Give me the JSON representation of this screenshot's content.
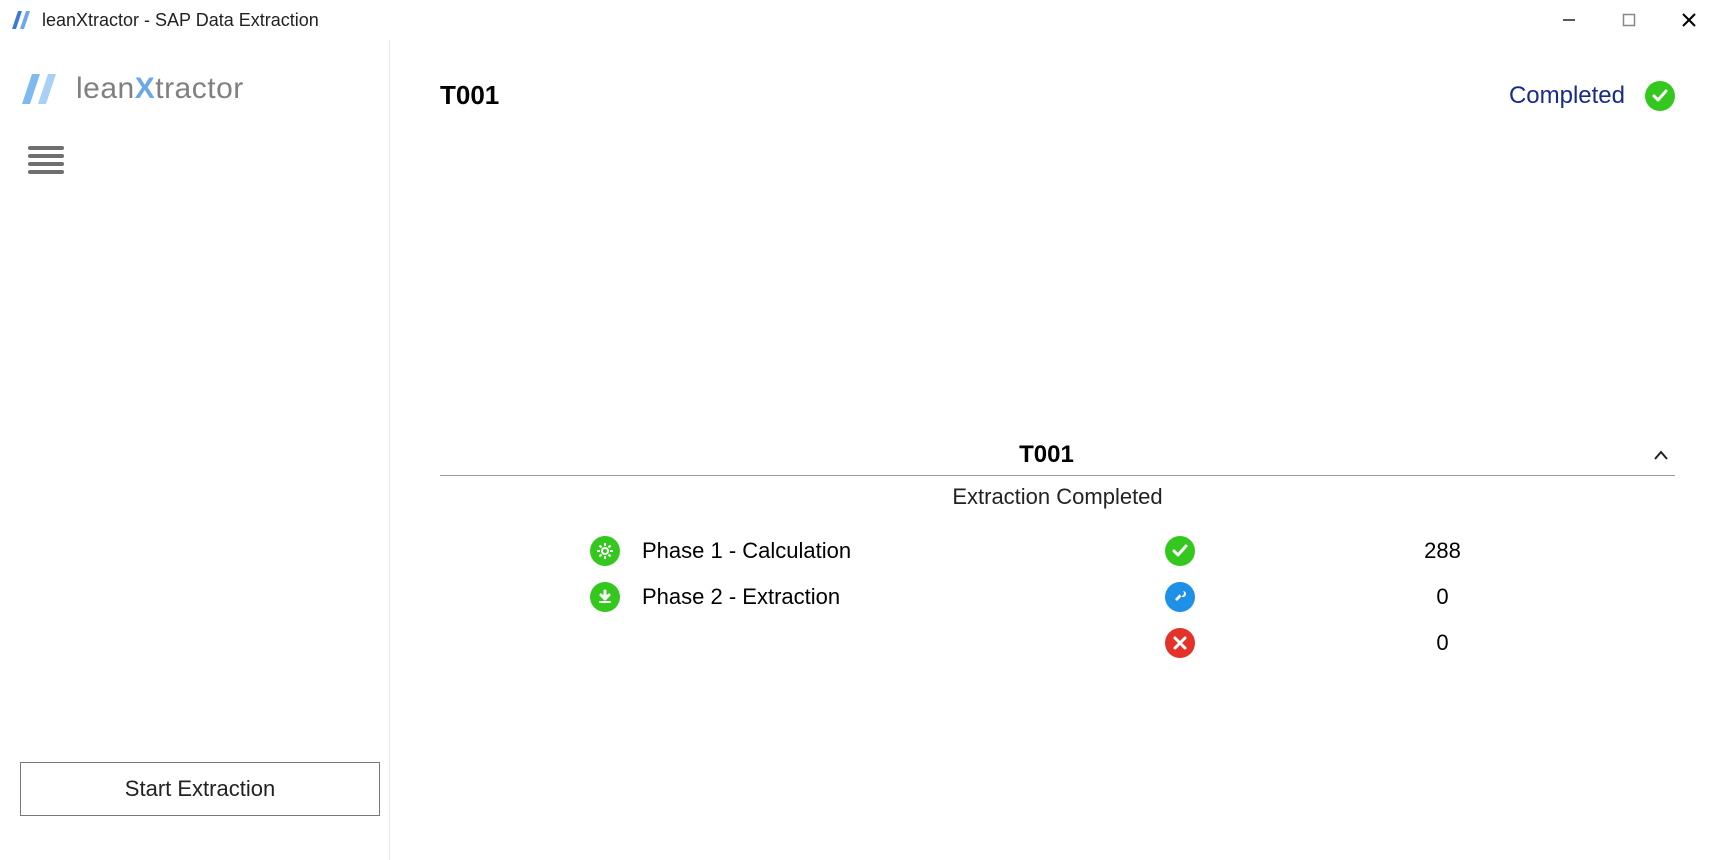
{
  "window": {
    "title": "leanXtractor - SAP Data Extraction"
  },
  "sidebar": {
    "brand_lean": "lean",
    "brand_x": "X",
    "brand_tractor": "tractor",
    "start_button": "Start Extraction"
  },
  "main": {
    "title": "T001",
    "status_label": "Completed",
    "section": {
      "title": "T001",
      "subtitle": "Extraction Completed",
      "rows": [
        {
          "label": "Phase 1 - Calculation",
          "count": "288",
          "icon": "gear",
          "status_icon": "check-green"
        },
        {
          "label": "Phase 2 - Extraction",
          "count": "0",
          "icon": "download",
          "status_icon": "wrench-blue"
        },
        {
          "label": "",
          "count": "0",
          "icon": "",
          "status_icon": "x-red"
        }
      ]
    }
  }
}
